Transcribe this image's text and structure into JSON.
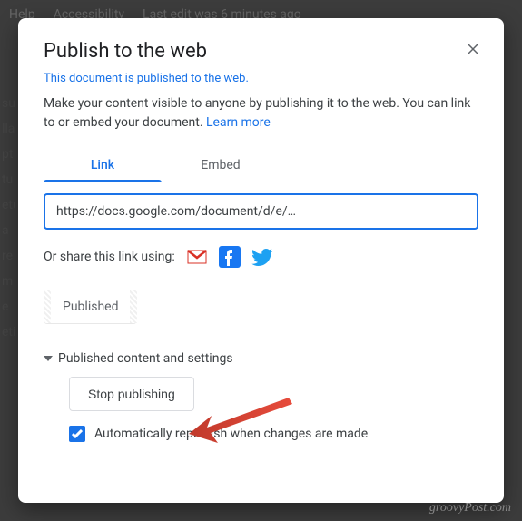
{
  "bg_menu": {
    "help": "Help",
    "accessibility": "Accessibility",
    "last_edit": "Last edit was 6 minutes ago"
  },
  "dialog": {
    "title": "Publish to the web",
    "status": "This document is published to the web.",
    "description_pre": "Make your content visible to anyone by publishing it to the web. You can link to or embed your document. ",
    "learn_more": "Learn more",
    "tabs": {
      "link": "Link",
      "embed": "Embed"
    },
    "url": "https://docs.google.com/document/d/e/…",
    "share_label": "Or share this link using:",
    "published_label": "Published",
    "expand_label": "Published content and settings",
    "stop_label": "Stop publishing",
    "auto_label": "Automatically republish when changes are made",
    "auto_checked": true
  },
  "watermark": "groovyPost.com",
  "bg_blurred": "su\nlla\npt\ntu\netu\n \na\nre\nm\ne\neti"
}
